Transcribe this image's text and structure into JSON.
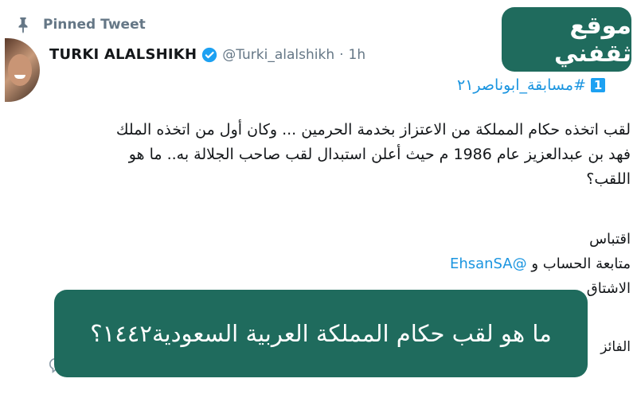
{
  "pinned": {
    "label": "Pinned Tweet",
    "icon": "pin-icon"
  },
  "tweet": {
    "name": "TURKI ALALSHIKH",
    "handle": "@Turki_alalshikh",
    "separator": "·",
    "time": "1h",
    "hashtag_number": "1",
    "hashtag": "#مسابقة_ابوناصر٢١",
    "body_lines": [
      "لقب اتخذه حكام المملكة من الاعتزاز بخدمة الحرمين ... وكان أول من اتخذه الملك",
      "فهد بن عبدالعزيز عام 1986 م حيث أعلن استبدال لقب صاحب الجلالة به.. ما هو",
      "اللقب؟"
    ],
    "conditions": [
      "اقتباس",
      "متابعة الحساب و",
      "الاشتاق"
    ],
    "mention": "@EhsanSA",
    "winner_prefix": "الفائز"
  },
  "overlay": {
    "site_badge": "موقع ثقفني",
    "question_banner": "ما هو لقب حكام المملكة العربية السعودية١٤٤٢؟",
    "color": "#1f6b5d"
  },
  "colors": {
    "link": "#1b95e0",
    "muted": "#657786",
    "verified": "#1da1f2"
  }
}
